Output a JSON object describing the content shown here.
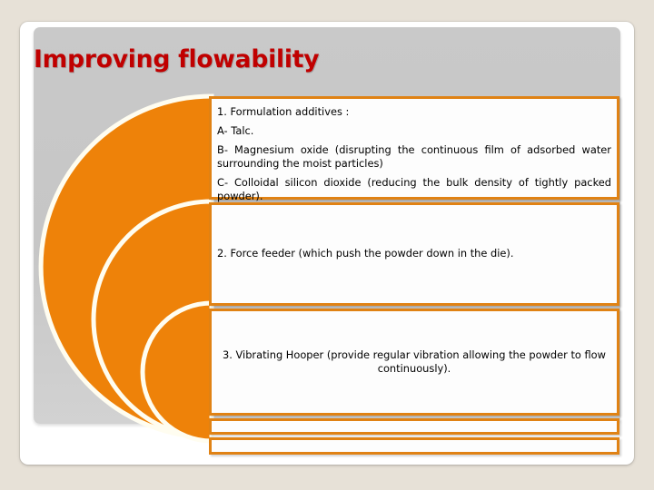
{
  "slide": {
    "title": "Improving flowability",
    "title_color": "#C00000",
    "accent_color": "#E08214",
    "panel_color": "#C8C8C8",
    "page_background": "#E7E1D7"
  },
  "decor": {
    "shape": "nested-semicircles",
    "count": 3,
    "fill_color": "#EE8209",
    "stroke_color": "#FFFDF0"
  },
  "content_boxes": [
    {
      "id": "box-formulation-additives",
      "lines": [
        {
          "text": "1. Formulation additives :",
          "align": "left"
        },
        {
          "text": "A- Talc.",
          "align": "left"
        },
        {
          "text": "B- Magnesium oxide (disrupting the continuous film of adsorbed water surrounding the moist particles)",
          "align": "justify"
        },
        {
          "text": "C- Colloidal silicon dioxide (reducing the bulk density of tightly packed powder).",
          "align": "justify"
        }
      ]
    },
    {
      "id": "box-force-feeder",
      "lines": [
        {
          "text": "2. Force feeder (which push the powder down in the die).",
          "align": "left"
        }
      ]
    },
    {
      "id": "box-vibrating-hooper",
      "lines": [
        {
          "text": "3. Vibrating Hooper (provide regular vibration allowing the powder to flow continuously).",
          "align": "center"
        }
      ]
    },
    {
      "id": "box-empty-1",
      "lines": []
    },
    {
      "id": "box-empty-2",
      "lines": []
    }
  ]
}
